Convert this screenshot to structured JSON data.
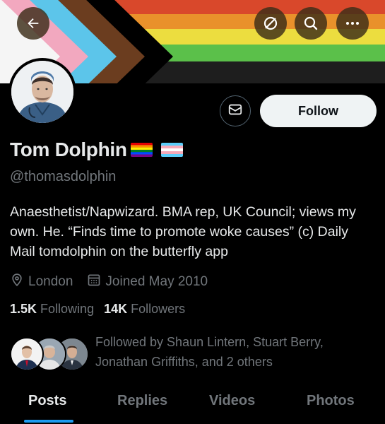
{
  "header": {
    "icons": [
      "back-arrow-icon",
      "hide-posts-icon",
      "search-icon",
      "more-icon"
    ]
  },
  "profile": {
    "name": "Tom Dolphin",
    "handle": "@thomasdolphin",
    "flags": [
      "rainbow-flag",
      "transgender-flag"
    ],
    "bio": "Anaesthetist/Napwizard. BMA rep, UK Council; views my own. He. “Finds time to promote woke causes” (c) Daily Mail tomdolphin on the butterfly app",
    "location": "London",
    "joined": "Joined May 2010",
    "following_count": "1.5K",
    "following_label": "Following",
    "followers_count": "14K",
    "followers_label": "Followers",
    "followed_by": "Followed by Shaun Lintern, Stuart Berry, Jonathan Griffiths, and 2 others"
  },
  "actions": {
    "follow_label": "Follow"
  },
  "tabs": [
    "Posts",
    "Replies",
    "Videos",
    "Photos"
  ],
  "active_tab": "Posts",
  "colors": {
    "background": "#000000",
    "accent": "#1d9bf0",
    "text_primary": "#e7e9ea",
    "text_secondary": "#71767b"
  }
}
